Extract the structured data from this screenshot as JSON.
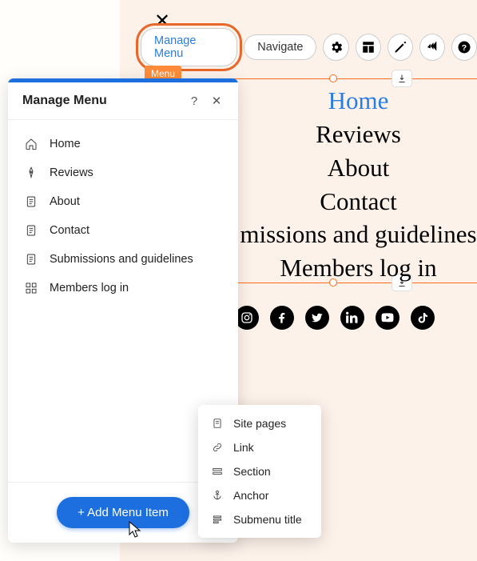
{
  "toolbar": {
    "manage_label": "Manage Menu",
    "navigate_label": "Navigate"
  },
  "element_tag": "Menu",
  "panel": {
    "title": "Manage Menu",
    "items": [
      {
        "label": "Home",
        "icon": "home-icon"
      },
      {
        "label": "Reviews",
        "icon": "pen-icon"
      },
      {
        "label": "About",
        "icon": "page-icon"
      },
      {
        "label": "Contact",
        "icon": "page-icon"
      },
      {
        "label": "Submissions and guidelines",
        "icon": "page-icon"
      },
      {
        "label": "Members log in",
        "icon": "grid-icon"
      }
    ],
    "add_label": "+ Add Menu Item"
  },
  "dropdown": {
    "items": [
      {
        "label": "Site pages",
        "icon": "page-icon"
      },
      {
        "label": "Link",
        "icon": "link-icon"
      },
      {
        "label": "Section",
        "icon": "section-icon"
      },
      {
        "label": "Anchor",
        "icon": "anchor-icon"
      },
      {
        "label": "Submenu title",
        "icon": "submenu-icon"
      }
    ]
  },
  "nav_preview": {
    "items": [
      {
        "label": "Home",
        "active": true
      },
      {
        "label": "Reviews"
      },
      {
        "label": "About"
      },
      {
        "label": "Contact"
      },
      {
        "label": "missions and guidelines"
      },
      {
        "label": "Members log in"
      }
    ]
  },
  "social": [
    "instagram",
    "facebook",
    "twitter",
    "linkedin",
    "youtube",
    "tiktok"
  ],
  "colors": {
    "accent_orange": "#ff6b1a",
    "accent_blue": "#1d6fe0",
    "link_blue": "#2a7de1"
  }
}
